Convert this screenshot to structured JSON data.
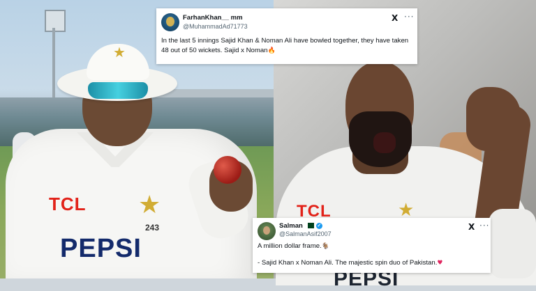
{
  "tweets": [
    {
      "display_name": "FarhanKhan__ mm",
      "handle": "@MuhammadAd71773",
      "text": "In the last 5 innings Sajid Khan & Noman Ali have bowled together, they have taken 48 out of 50 wickets. Sajid x Noman",
      "emoji": "🔥",
      "x_logo": "X",
      "more": "···"
    },
    {
      "display_name": "Salman",
      "handle": "@SalmanAsif2007",
      "line1": "A million dollar frame.",
      "line1_emoji": "🐐",
      "line2": "- Sajid Khan x Noman Ali. The majestic spin duo of Pakistan.",
      "line2_emoji": "♥",
      "x_logo": "X",
      "more": "···",
      "verified": "✓"
    }
  ],
  "left_photo": {
    "sponsor_top": "TCL",
    "sponsor_main": "PEPSI",
    "shirt_number": "243",
    "star": "★"
  },
  "right_photo": {
    "sponsor_top": "TCL",
    "sponsor_main": "PEPSI",
    "star": "★"
  },
  "colors": {
    "tweet_bg": "#ffffff",
    "text_primary": "#0f1419",
    "text_secondary": "#536471",
    "verified_blue": "#1d9bf0",
    "tcl_red": "#e2231a",
    "pepsi_navy": "#132a6b",
    "star_gold": "#d1ac33"
  }
}
